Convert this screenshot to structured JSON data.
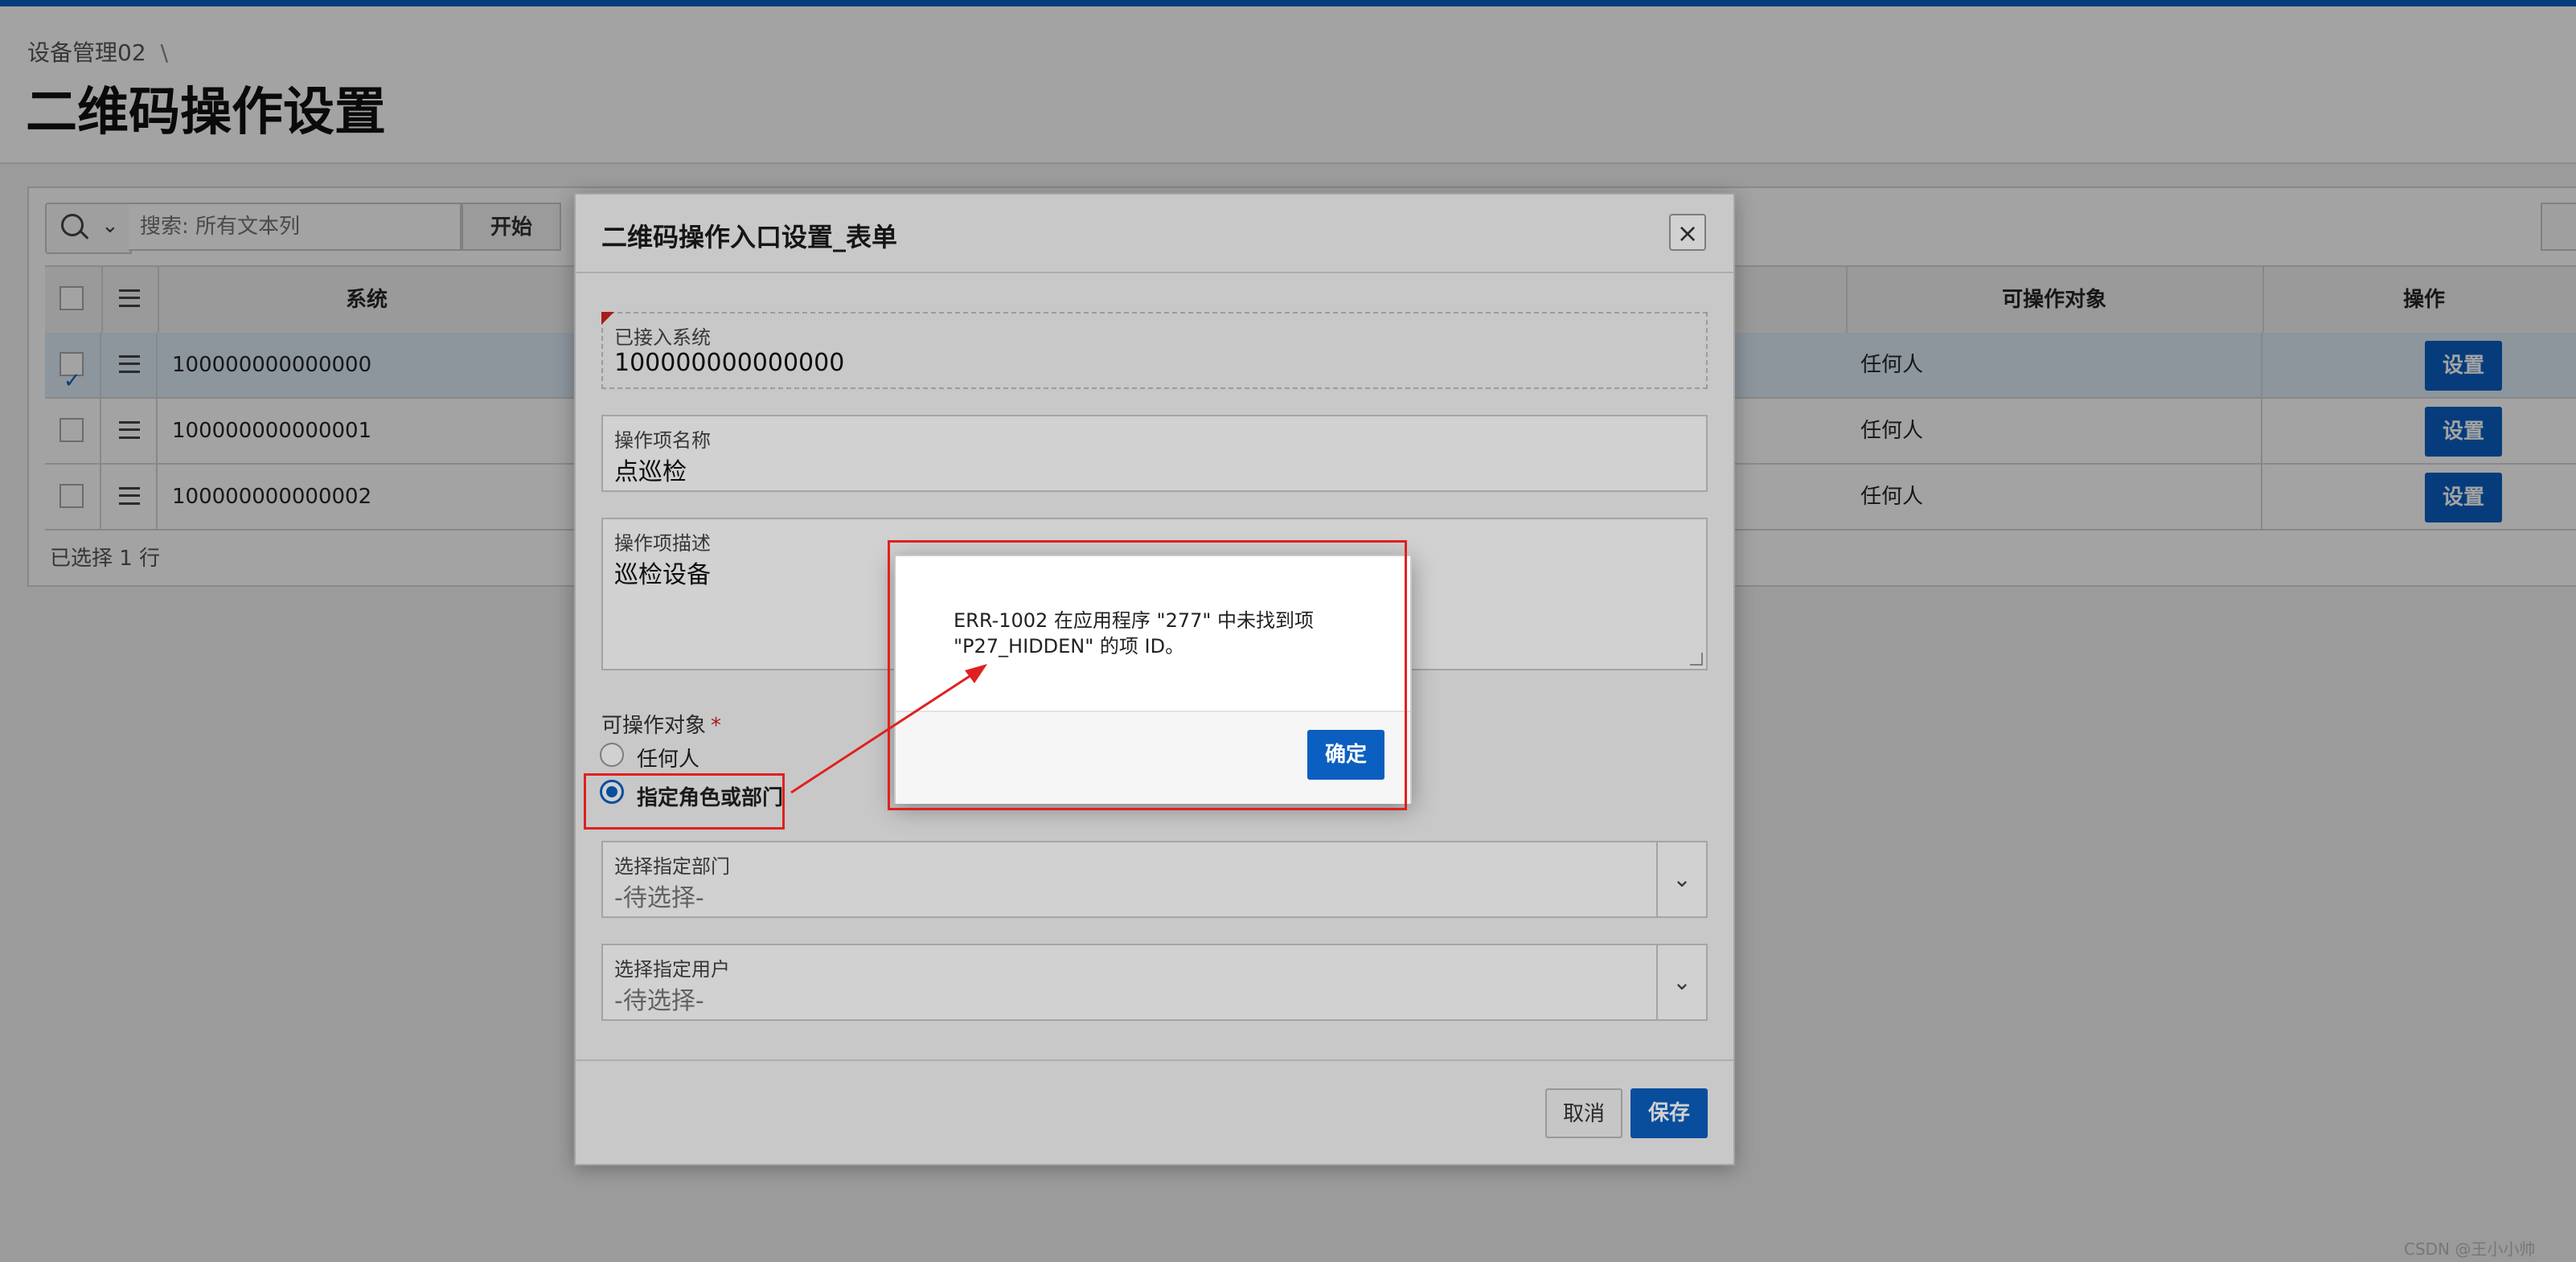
{
  "breadcrumb": {
    "parent": "设备管理02",
    "separator": "\\"
  },
  "page_title": "二维码操作设置",
  "toolbar": {
    "search_placeholder": "搜索: 所有文本列",
    "go_label": "开始"
  },
  "table": {
    "headers": {
      "system": "系统",
      "target": "可操作对象",
      "action": "操作"
    },
    "rows": [
      {
        "system": "100000000000000",
        "target": "任何人",
        "action": "设置",
        "checked": true
      },
      {
        "system": "100000000000001",
        "target": "任何人",
        "action": "设置",
        "checked": false
      },
      {
        "system": "100000000000002",
        "target": "任何人",
        "action": "设置",
        "checked": false
      }
    ],
    "selected_count": "已选择 1 行"
  },
  "dialog": {
    "title": "二维码操作入口设置_表单",
    "close_icon": "close-icon",
    "fields": {
      "system": {
        "label": "已接入系统",
        "value": "100000000000000"
      },
      "name": {
        "label": "操作项名称",
        "value": "点巡检"
      },
      "desc": {
        "label": "操作项描述",
        "value": "巡检设备"
      },
      "target": {
        "label": "可操作对象",
        "required_mark": "*",
        "options": [
          "任何人",
          "指定角色或部门"
        ],
        "selected": "指定角色或部门"
      },
      "dept": {
        "label": "选择指定部门",
        "placeholder": "-待选择-"
      },
      "user": {
        "label": "选择指定用户",
        "placeholder": "-待选择-"
      }
    },
    "cancel_label": "取消",
    "save_label": "保存"
  },
  "alert": {
    "message": "ERR-1002 在应用程序 \"277\" 中未找到项 \"P27_HIDDEN\" 的项 ID。",
    "ok_label": "确定"
  },
  "colors": {
    "accent": "#0b5fc0",
    "annotation": "#e02020"
  },
  "watermark": "CSDN @王小小帅"
}
